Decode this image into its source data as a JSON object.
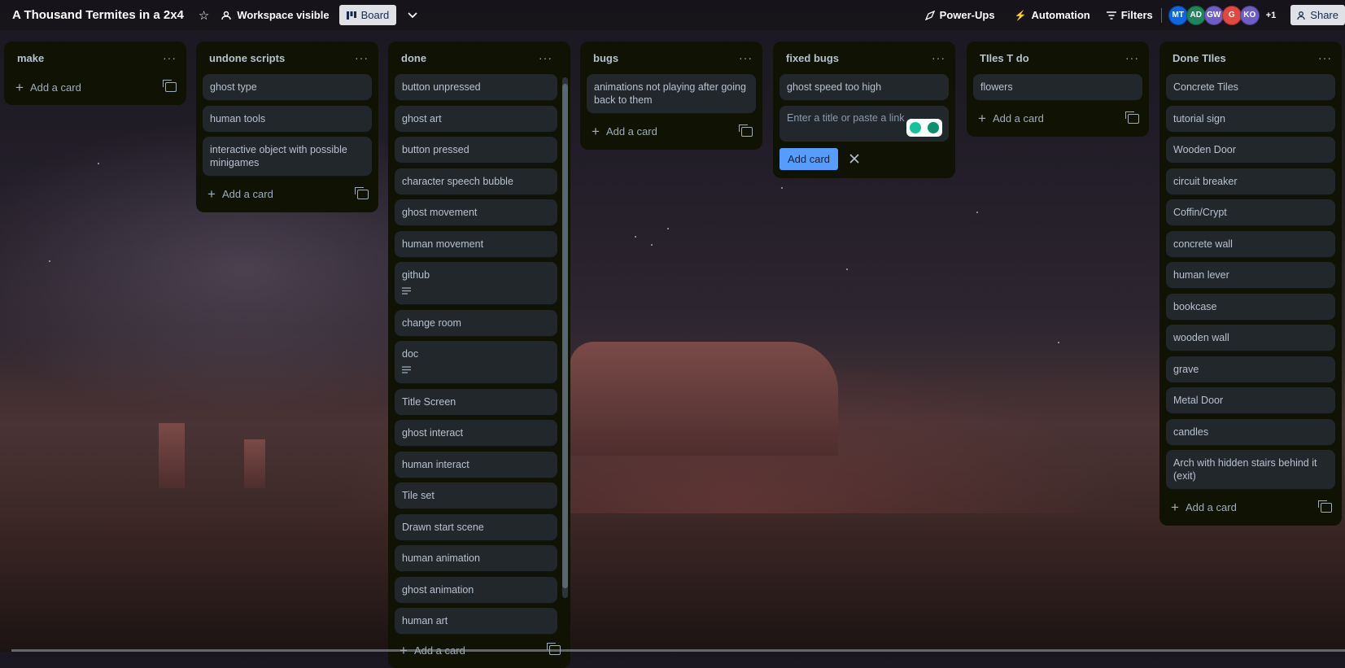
{
  "header": {
    "board_title": "A Thousand Termites in a 2x4",
    "visibility_label": "Workspace visible",
    "view_label": "Board",
    "powerups_label": "Power-Ups",
    "automation_label": "Automation",
    "filters_label": "Filters",
    "members": [
      {
        "initials": "MT",
        "color": "#0c66e4"
      },
      {
        "initials": "AD",
        "color": "#1f845a"
      },
      {
        "initials": "GW",
        "color": "#6e5dc6"
      },
      {
        "initials": "G",
        "color": "#e2483d"
      },
      {
        "initials": "KO",
        "color": "#6e5dc6"
      }
    ],
    "members_more": "+1",
    "share_label": "Share"
  },
  "lists": {
    "make": {
      "title": "make",
      "add_label": "Add a card",
      "cards": []
    },
    "undone": {
      "title": "undone scripts",
      "add_label": "Add a card",
      "cards": [
        "ghost type",
        "human tools",
        "interactive object with possible minigames"
      ]
    },
    "done": {
      "title": "done",
      "add_label": "Add a card",
      "cards": [
        "button unpressed",
        "ghost art",
        "button pressed",
        "character speech bubble",
        "ghost movement",
        "human movement",
        "github",
        "change room",
        "doc",
        "Title Screen",
        "ghost interact",
        "human interact",
        "Tile set",
        "Drawn start scene",
        "human animation",
        "ghost animation",
        "human art"
      ]
    },
    "bugs": {
      "title": "bugs",
      "add_label": "Add a card",
      "cards": [
        "animations not playing after going back to them"
      ]
    },
    "fixed": {
      "title": "fixed bugs",
      "cards": [
        "ghost speed too high"
      ],
      "composer_placeholder": "Enter a title or paste a link",
      "add_button": "Add card"
    },
    "tiles_todo": {
      "title": "TIles T do",
      "add_label": "Add a card",
      "cards": [
        "flowers"
      ]
    },
    "done_tiles": {
      "title": "Done TIles",
      "add_label": "Add a card",
      "cards": [
        "Concrete Tiles",
        "tutorial sign",
        "Wooden Door",
        "circuit breaker",
        "Coffin/Crypt",
        "concrete wall",
        "human lever",
        "bookcase",
        "wooden wall",
        "grave",
        "Metal Door",
        "candles",
        "Arch with hidden stairs behind it (exit)"
      ]
    }
  }
}
